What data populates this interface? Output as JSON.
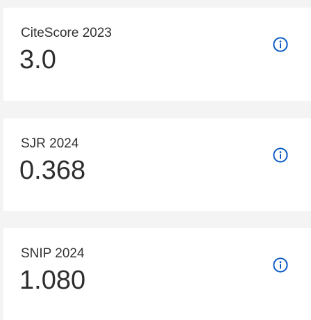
{
  "colors": {
    "page_background": "#f4f4f4",
    "card_background": "#ffffff",
    "text": "#2e2e2e",
    "info_icon": "#0c5bc4"
  },
  "metrics": [
    {
      "label": "CiteScore 2023",
      "value": "3.0",
      "icon": "info-icon"
    },
    {
      "label": "SJR 2024",
      "value": "0.368",
      "icon": "info-icon"
    },
    {
      "label": "SNIP 2024",
      "value": "1.080",
      "icon": "info-icon"
    }
  ]
}
